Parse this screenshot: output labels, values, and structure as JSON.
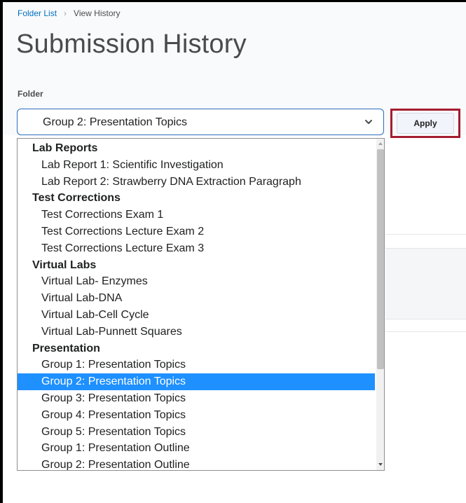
{
  "breadcrumb": {
    "root": "Folder List",
    "current": "View History"
  },
  "page_title": "Submission History",
  "folder": {
    "label": "Folder",
    "selected": "Group 2: Presentation Topics",
    "apply_label": "Apply"
  },
  "dropdown_options": [
    {
      "text": "Lab Reports",
      "type": "group"
    },
    {
      "text": "Lab Report 1: Scientific Investigation",
      "type": "item"
    },
    {
      "text": "Lab Report 2: Strawberry DNA Extraction Paragraph",
      "type": "item"
    },
    {
      "text": "Test Corrections",
      "type": "group"
    },
    {
      "text": "Test Corrections Exam 1",
      "type": "item"
    },
    {
      "text": "Test Corrections Lecture Exam 2",
      "type": "item"
    },
    {
      "text": "Test Corrections Lecture Exam 3",
      "type": "item"
    },
    {
      "text": "Virtual Labs",
      "type": "group"
    },
    {
      "text": "Virtual Lab- Enzymes",
      "type": "item"
    },
    {
      "text": "Virtual Lab-DNA",
      "type": "item"
    },
    {
      "text": "Virtual Lab-Cell Cycle",
      "type": "item"
    },
    {
      "text": "Virtual Lab-Punnett Squares",
      "type": "item"
    },
    {
      "text": "Presentation",
      "type": "group"
    },
    {
      "text": "Group 1: Presentation Topics",
      "type": "item"
    },
    {
      "text": "Group 2: Presentation Topics",
      "type": "item",
      "selected": true
    },
    {
      "text": "Group 3: Presentation Topics",
      "type": "item"
    },
    {
      "text": "Group 4: Presentation Topics",
      "type": "item"
    },
    {
      "text": "Group 5: Presentation Topics",
      "type": "item"
    },
    {
      "text": "Group 1: Presentation Outline",
      "type": "item"
    },
    {
      "text": "Group 2: Presentation Outline",
      "type": "item"
    }
  ],
  "colors": {
    "link": "#006fbf",
    "selection": "#1e90ff",
    "apply_highlight": "#a51c30",
    "select_border": "#2a6fbd"
  },
  "icons": {
    "select_arrow": "chevron-down-icon",
    "breadcrumb_separator": "chevron-right-icon"
  }
}
